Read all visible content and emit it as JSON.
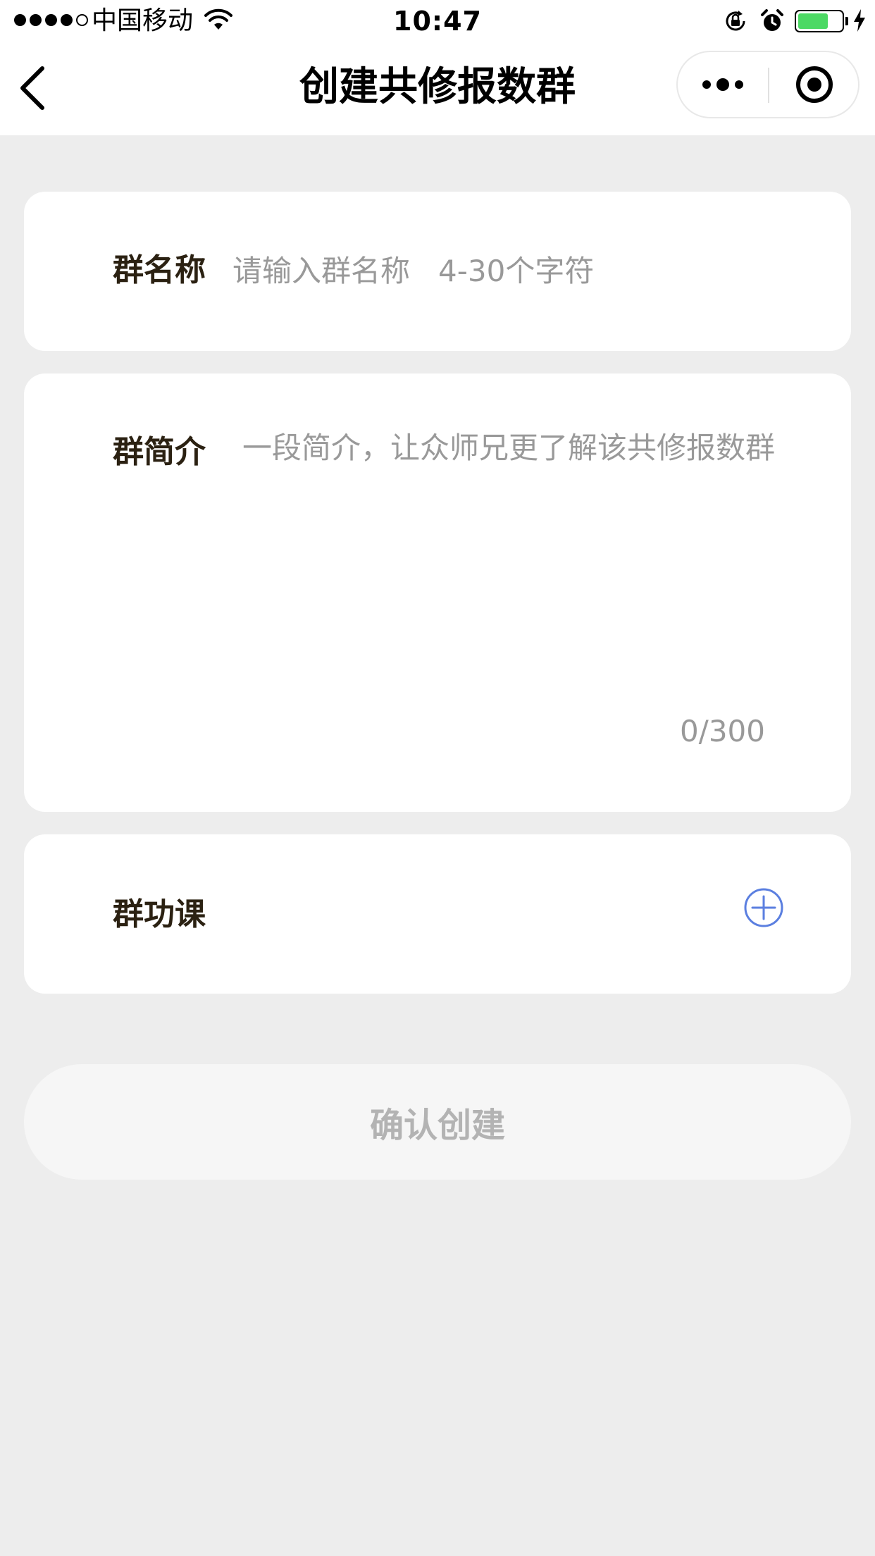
{
  "status_bar": {
    "carrier": "中国移动",
    "time": "10:47",
    "battery_level": 0.7,
    "battery_color": "#4cd964"
  },
  "nav": {
    "title": "创建共修报数群",
    "back_icon": "chevron-left-icon",
    "more_icon": "more-dots-icon",
    "close_icon": "target-circle-icon"
  },
  "form": {
    "name": {
      "label": "群名称",
      "placeholder": "请输入群名称   4-30个字符",
      "value": ""
    },
    "intro": {
      "label": "群简介",
      "placeholder": "一段简介，让众师兄更了解该共修报数群",
      "value": "",
      "counter": "0/300"
    },
    "lesson": {
      "label": "群功课",
      "add_icon": "plus-circle-icon",
      "accent_color": "#5b7fe0"
    }
  },
  "confirm_button": {
    "label": "确认创建"
  }
}
